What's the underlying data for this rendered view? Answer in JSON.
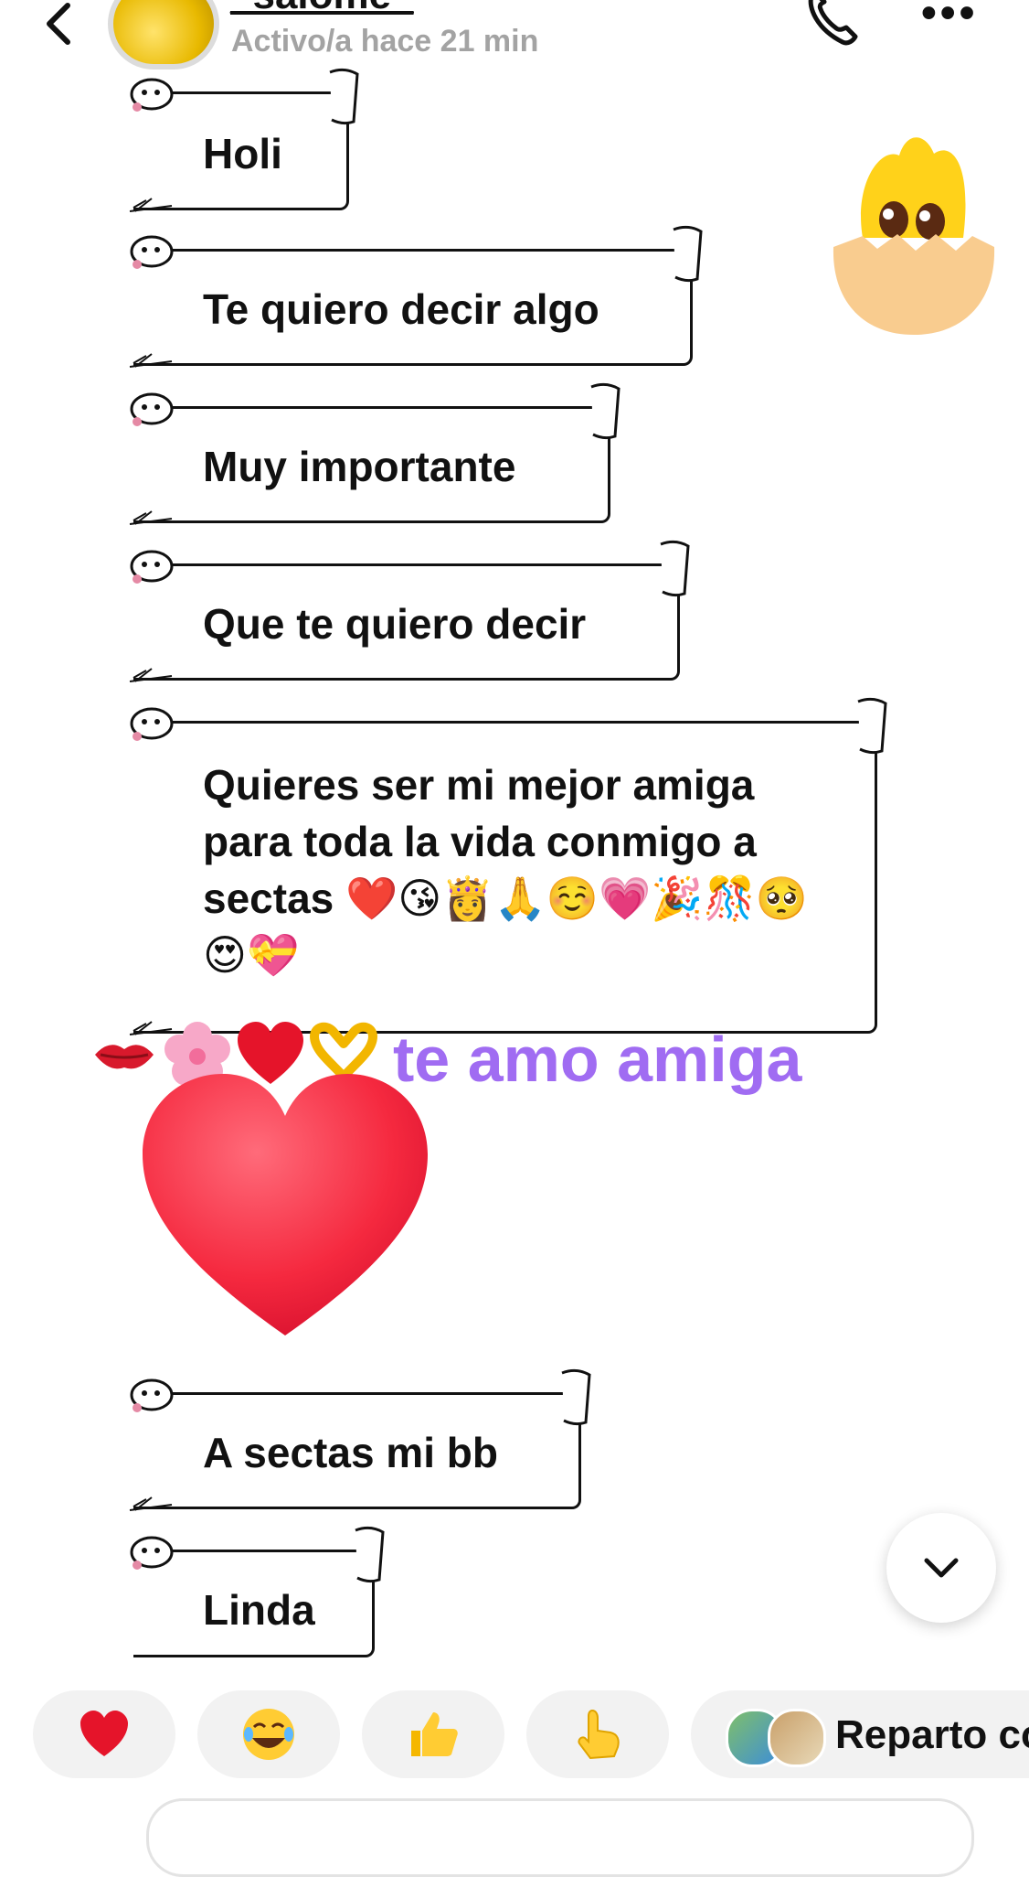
{
  "header": {
    "username": "_salome_",
    "status": "Activo/a hace 21 min",
    "back_icon": "chevron-left-icon",
    "call_icon": "phone-icon",
    "more_icon": "more-icon",
    "more_label": "•••"
  },
  "messages": [
    {
      "text": "Holi"
    },
    {
      "text": "Te quiero decir algo"
    },
    {
      "text": "Muy importante"
    },
    {
      "text": "Que te quiero decir"
    },
    {
      "text": "Quieres ser mi mejor amiga para toda la vida conmigo a sectas ❤️😘👸🙏☺️💗🎉🎊🥺😍💝"
    },
    {
      "text": "A sectas mi bb"
    },
    {
      "text": "Linda"
    }
  ],
  "reply": {
    "emojis": "💋🌸❤️🫶",
    "text": "te amo amiga",
    "color": "#a06cf2"
  },
  "quick_reactions": [
    {
      "icon": "heart-icon"
    },
    {
      "icon": "laughing-icon"
    },
    {
      "icon": "thumbs-up-icon"
    },
    {
      "icon": "pointing-hand-icon"
    }
  ],
  "share": {
    "label": "Reparto co"
  }
}
